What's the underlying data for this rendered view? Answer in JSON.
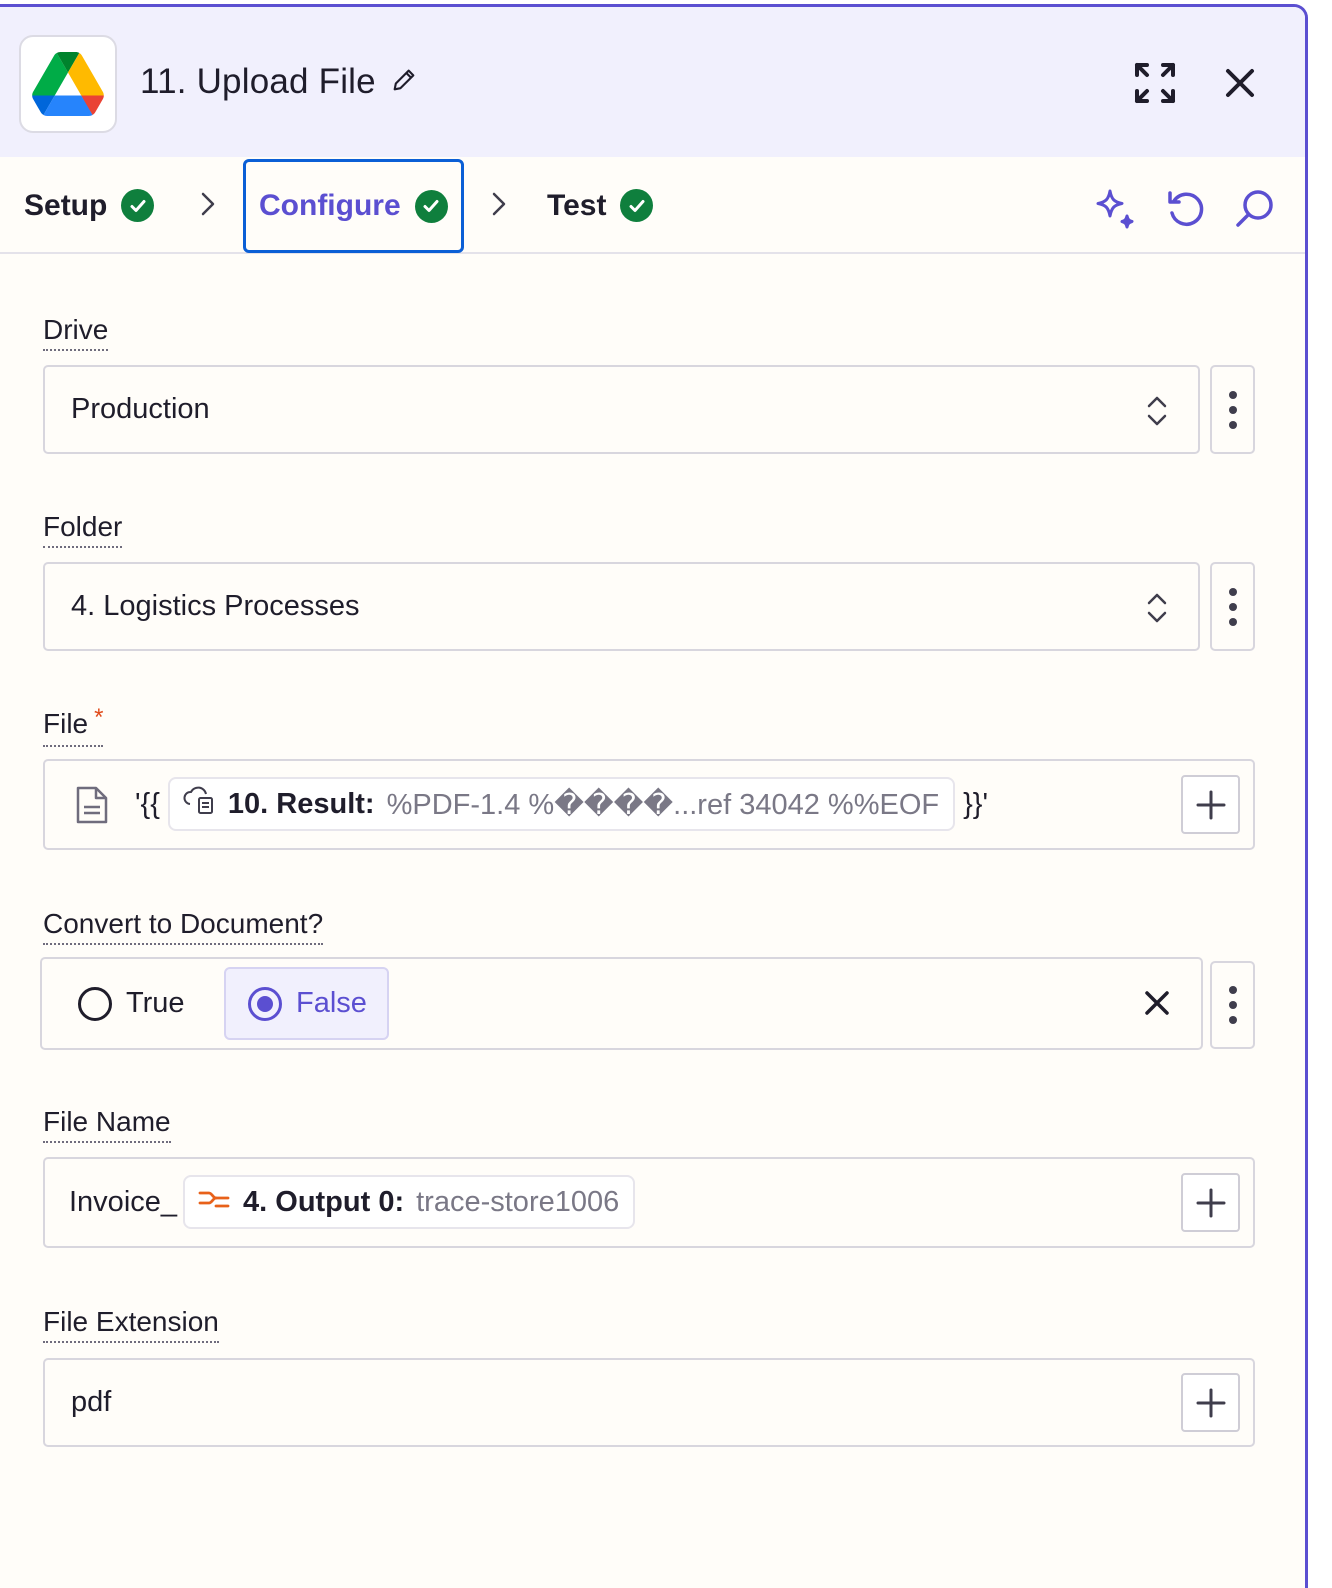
{
  "header": {
    "title": "11. Upload File",
    "app_icon": "google-drive-icon",
    "edit_icon": "pencil-icon",
    "expand_icon": "expand-icon",
    "close_icon": "close-icon"
  },
  "tabs": [
    {
      "label": "Setup",
      "status": "complete"
    },
    {
      "label": "Configure",
      "status": "complete",
      "active": true
    },
    {
      "label": "Test",
      "status": "complete"
    }
  ],
  "toolbar": {
    "icons": [
      "sparkle-icon",
      "undo-icon",
      "search-icon"
    ]
  },
  "fields": {
    "drive": {
      "label": "Drive",
      "value": "Production"
    },
    "folder": {
      "label": "Folder",
      "value": "4. Logistics Processes"
    },
    "file": {
      "label": "File",
      "required_mark": "*",
      "prefix": "'{{",
      "pill_step": "10. Result:",
      "pill_value": "%PDF-1.4 %����...ref 34042 %%EOF",
      "suffix": "}}'"
    },
    "convert": {
      "label": "Convert to Document?",
      "options": [
        "True",
        "False"
      ],
      "selected": "False"
    },
    "file_name": {
      "label": "File Name",
      "prefix": "Invoice_",
      "pill_step": "4. Output 0:",
      "pill_value": "trace-store1006"
    },
    "file_extension": {
      "label": "File Extension",
      "value": "pdf"
    }
  },
  "colors": {
    "accent": "#5b4fd1",
    "focus_border": "#0b5fd6",
    "success": "#0f7f3d",
    "required": "#e04a1a",
    "formatter": "#e8611a"
  }
}
